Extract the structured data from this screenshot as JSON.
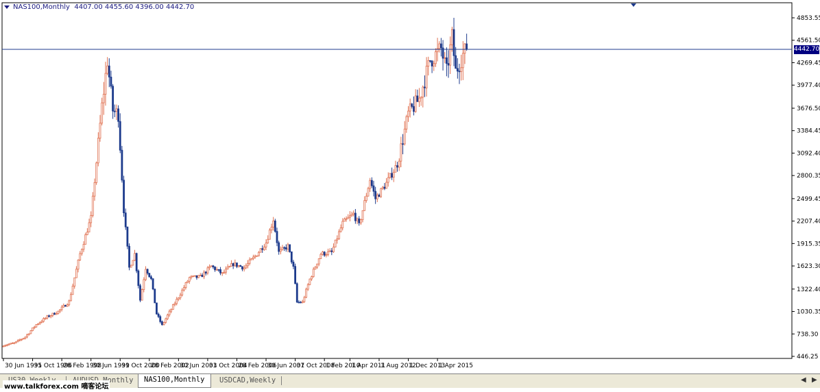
{
  "header": {
    "symbol": "NAS100,Monthly",
    "ohlc": "4407.00 4455.60 4396.00 4442.70"
  },
  "current_price": "4442.70",
  "tabs": [
    {
      "label": "US30,Weekly",
      "active": false
    },
    {
      "label": "AUDUSD,Monthly",
      "active": false
    },
    {
      "label": "NAS100,Monthly",
      "active": true
    },
    {
      "label": "USDCAD,Weekly",
      "active": false
    }
  ],
  "watermark": "www.talkforex.com 嘀客论坛",
  "colors": {
    "bull": "#e07050",
    "bear": "#1c3a8c",
    "grid": "#000000",
    "price_line": "#1c3a8c",
    "price_box": "#000080"
  },
  "chart_data": {
    "type": "candlestick",
    "title": "NAS100,Monthly",
    "ylim": [
      446.25,
      4853.55
    ],
    "y_ticks": [
      "4853.55",
      "4561.50",
      "4269.45",
      "3977.40",
      "3676.50",
      "3384.45",
      "3092.40",
      "2800.35",
      "2499.45",
      "2207.40",
      "1915.35",
      "1623.30",
      "1322.40",
      "1030.35",
      "738.30",
      "446.25"
    ],
    "x_ticks": [
      "30 Jun 1995",
      "31 Oct 1996",
      "28 Feb 1998",
      "30 Jun 1999",
      "31 Oct 2000",
      "28 Feb 2002",
      "30 Jun 2003",
      "31 Oct 2004",
      "28 Feb 2006",
      "30 Jun 2007",
      "31 Oct 2008",
      "1 Feb 2010",
      "1 Apr 2011",
      "1 Aug 2012",
      "1 Dec 2013",
      "1 Apr 2015"
    ],
    "anchors": [
      [
        "1995-06",
        590
      ],
      [
        "1995-12",
        620
      ],
      [
        "1996-06",
        700
      ],
      [
        "1996-12",
        860
      ],
      [
        "1997-06",
        960
      ],
      [
        "1997-12",
        1030
      ],
      [
        "1998-06",
        1160
      ],
      [
        "1998-12",
        1780
      ],
      [
        "1999-06",
        2250
      ],
      [
        "1999-12",
        3700
      ],
      [
        "2000-03",
        4300
      ],
      [
        "2000-06",
        3650
      ],
      [
        "2000-09",
        3600
      ],
      [
        "2000-12",
        2350
      ],
      [
        "2001-03",
        1600
      ],
      [
        "2001-06",
        1780
      ],
      [
        "2001-09",
        1180
      ],
      [
        "2001-12",
        1600
      ],
      [
        "2002-03",
        1450
      ],
      [
        "2002-06",
        1000
      ],
      [
        "2002-09",
        850
      ],
      [
        "2002-12",
        980
      ],
      [
        "2003-06",
        1220
      ],
      [
        "2003-12",
        1470
      ],
      [
        "2004-06",
        1480
      ],
      [
        "2004-12",
        1620
      ],
      [
        "2005-06",
        1520
      ],
      [
        "2005-12",
        1650
      ],
      [
        "2006-06",
        1600
      ],
      [
        "2006-12",
        1750
      ],
      [
        "2007-06",
        1930
      ],
      [
        "2007-10",
        2230
      ],
      [
        "2008-01",
        1800
      ],
      [
        "2008-06",
        1880
      ],
      [
        "2008-09",
        1600
      ],
      [
        "2008-11",
        1150
      ],
      [
        "2009-02",
        1150
      ],
      [
        "2009-06",
        1450
      ],
      [
        "2009-12",
        1780
      ],
      [
        "2010-06",
        1800
      ],
      [
        "2010-12",
        2180
      ],
      [
        "2011-06",
        2300
      ],
      [
        "2011-09",
        2150
      ],
      [
        "2012-03",
        2750
      ],
      [
        "2012-06",
        2500
      ],
      [
        "2012-12",
        2700
      ],
      [
        "2013-06",
        2950
      ],
      [
        "2013-12",
        3600
      ],
      [
        "2014-06",
        3800
      ],
      [
        "2014-12",
        4300
      ],
      [
        "2015-06",
        4450
      ],
      [
        "2015-09",
        4150
      ],
      [
        "2015-12",
        4600
      ],
      [
        "2016-02",
        4150
      ],
      [
        "2016-06",
        4380
      ],
      [
        "2016-08",
        4443
      ]
    ]
  }
}
